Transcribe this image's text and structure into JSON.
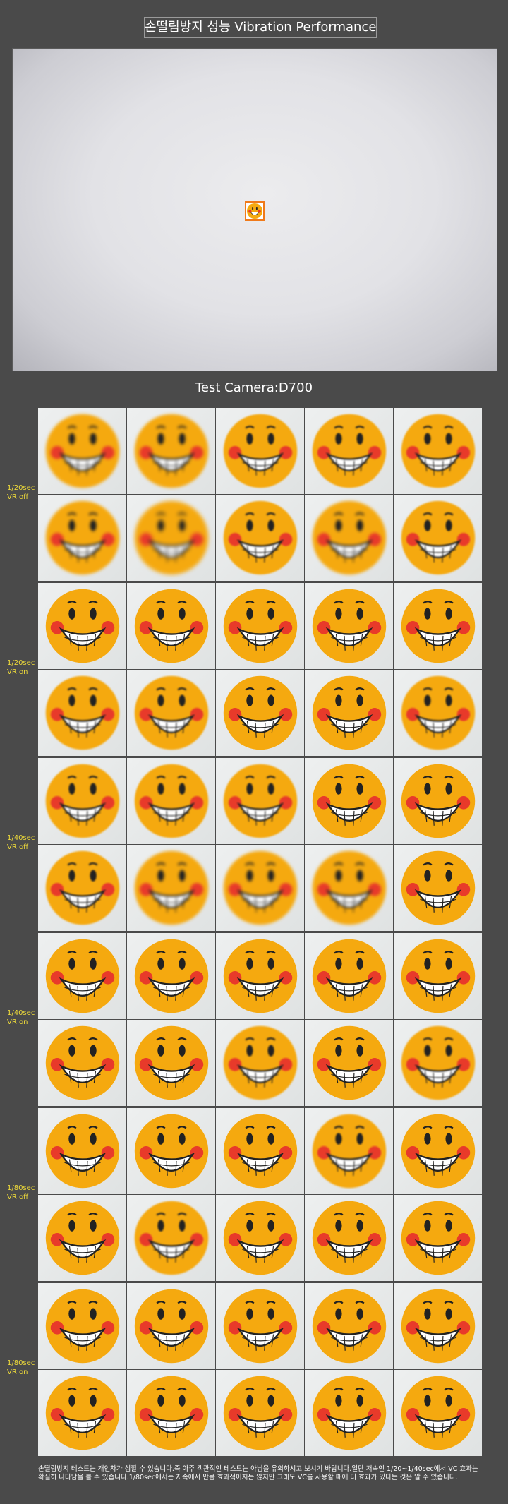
{
  "title": "손떨림방지 성능 Vibration Performance",
  "camera_label": "Test Camera:D700",
  "colors": {
    "background": "#4a4a4a",
    "label_text": "#f0dc3a",
    "face": "#f5a90f",
    "cheek": "#e83a2a"
  },
  "groups": [
    {
      "shutter": "1/20sec",
      "vr": "VR off",
      "blur": [
        [
          2,
          2,
          1,
          1,
          1
        ],
        [
          2,
          3,
          1,
          2,
          1
        ]
      ]
    },
    {
      "shutter": "1/20sec",
      "vr": "VR on",
      "blur": [
        [
          0,
          0,
          0,
          0,
          0
        ],
        [
          1,
          1,
          0,
          0,
          1
        ]
      ]
    },
    {
      "shutter": "1/40sec",
      "vr": "VR off",
      "blur": [
        [
          1,
          1,
          1,
          0,
          0
        ],
        [
          1,
          2,
          2,
          2,
          0
        ]
      ]
    },
    {
      "shutter": "1/40sec",
      "vr": "VR on",
      "blur": [
        [
          0,
          0,
          0,
          0,
          0
        ],
        [
          0,
          0,
          1,
          0,
          1
        ]
      ]
    },
    {
      "shutter": "1/80sec",
      "vr": "VR off",
      "blur": [
        [
          0,
          0,
          0,
          1,
          0
        ],
        [
          0,
          1,
          0,
          0,
          0
        ]
      ]
    },
    {
      "shutter": "1/80sec",
      "vr": "VR on",
      "blur": [
        [
          0,
          0,
          0,
          0,
          0
        ],
        [
          0,
          0,
          0,
          0,
          0
        ]
      ]
    }
  ],
  "footnote": "손떨림방지 테스트는 개인차가 심할 수 있습니다.즉 아주 객관적인 테스트는 아님을 유의하시고 보시기 바랍니다.일단 저속인 1/20~1/40sec에서 VC 효과는 확실히 나타남을 볼 수 있습니다.1/80sec에서는 저속에서 만큼 효과적이지는 않지만 그래도 VC를 사용할 때에 더 효과가 있다는 것은 알 수 있습니다."
}
